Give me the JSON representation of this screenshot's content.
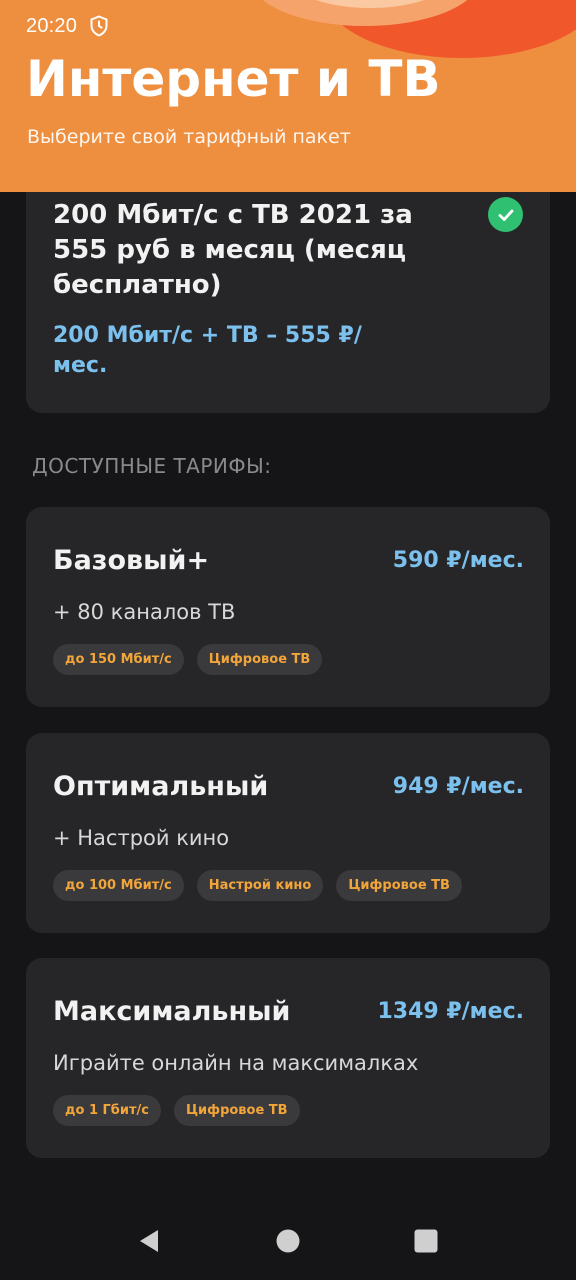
{
  "status_bar": {
    "time": "20:20",
    "icons": [
      "shield-icon"
    ]
  },
  "header": {
    "title": "Интернет и ТВ",
    "subtitle": "Выберите свой тарифный пакет",
    "background_color": "#ee8e3f"
  },
  "current_tariff": {
    "name": "200 Мбит/с с ТВ 2021 за 555 руб в месяц (месяц бесплатно)",
    "price_line": "200 Мбит/с + ТВ – 555 ₽/мес.",
    "selected": true,
    "selected_icon": "check-circle-icon"
  },
  "section_label": "ДОСТУПНЫЕ ТАРИФЫ:",
  "tariffs": [
    {
      "name": "Базовый+",
      "price": "590 ₽/мес.",
      "description": "+ 80 каналов ТВ",
      "chips": [
        "до 150 Мбит/с",
        "Цифровое ТВ"
      ]
    },
    {
      "name": "Оптимальный",
      "price": "949 ₽/мес.",
      "description": "+ Настрой кино",
      "chips": [
        "до 100 Мбит/с",
        "Настрой кино",
        "Цифровое ТВ"
      ]
    },
    {
      "name": "Максимальный",
      "price": "1349 ₽/мес.",
      "description": "Играйте онлайн на максималках",
      "chips": [
        "до 1 Гбит/с",
        "Цифровое ТВ"
      ]
    }
  ],
  "nav_bar": {
    "buttons": [
      "back-icon",
      "home-icon",
      "recents-icon"
    ]
  },
  "colors": {
    "accent_orange": "#ee8e3f",
    "price_blue": "#7cc0ee",
    "chip_text": "#f2a53a",
    "check_green": "#2fc071",
    "card_bg": "#262628",
    "screen_bg": "#151518"
  }
}
